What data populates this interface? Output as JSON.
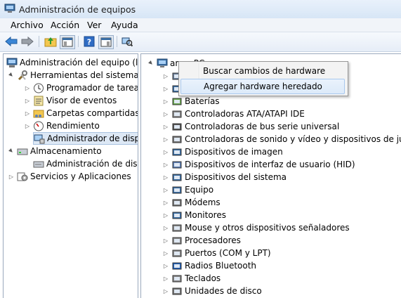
{
  "window": {
    "title": "Administración de equipos"
  },
  "menu": [
    "Archivo",
    "Acción",
    "Ver",
    "Ayuda"
  ],
  "left_tree": [
    {
      "label": "Administración del equipo (loc",
      "level": 0,
      "expander": "",
      "icon": "computer-management-icon"
    },
    {
      "label": "Herramientas del sistema",
      "level": 1,
      "expander": "▲",
      "icon": "tools-icon"
    },
    {
      "label": "Programador de tareas",
      "level": 2,
      "expander": "▷",
      "icon": "clock-icon"
    },
    {
      "label": "Visor de eventos",
      "level": 2,
      "expander": "▷",
      "icon": "event-viewer-icon"
    },
    {
      "label": "Carpetas compartidas",
      "level": 2,
      "expander": "▷",
      "icon": "shared-folder-icon"
    },
    {
      "label": "Rendimiento",
      "level": 2,
      "expander": "▷",
      "icon": "performance-icon"
    },
    {
      "label": "Administrador de dispo",
      "level": 2,
      "expander": "",
      "icon": "device-manager-icon",
      "selected": true
    },
    {
      "label": "Almacenamiento",
      "level": 1,
      "expander": "▲",
      "icon": "storage-icon"
    },
    {
      "label": "Administración de disco",
      "level": 2,
      "expander": "",
      "icon": "disk-management-icon"
    },
    {
      "label": "Servicios y Aplicaciones",
      "level": 1,
      "expander": "▷",
      "icon": "services-icon"
    }
  ],
  "device_tree": {
    "root": "angy-PC",
    "items": [
      {
        "label": "",
        "icon": "disk-drive-icon"
      },
      {
        "label": "",
        "icon": "network-adapter-icon"
      },
      {
        "label": "Baterías",
        "icon": "battery-icon"
      },
      {
        "label": "Controladoras ATA/ATAPI IDE",
        "icon": "ide-controller-icon"
      },
      {
        "label": "Controladoras de bus serie universal",
        "icon": "usb-icon"
      },
      {
        "label": "Controladoras de sonido y vídeo y dispositivos de juego",
        "icon": "sound-icon"
      },
      {
        "label": "Dispositivos de imagen",
        "icon": "imaging-icon"
      },
      {
        "label": "Dispositivos de interfaz de usuario (HID)",
        "icon": "hid-icon"
      },
      {
        "label": "Dispositivos del sistema",
        "icon": "system-devices-icon"
      },
      {
        "label": "Equipo",
        "icon": "computer-icon"
      },
      {
        "label": "Módems",
        "icon": "modem-icon"
      },
      {
        "label": "Monitores",
        "icon": "monitor-icon"
      },
      {
        "label": "Mouse y otros dispositivos señaladores",
        "icon": "mouse-icon"
      },
      {
        "label": "Procesadores",
        "icon": "processor-icon"
      },
      {
        "label": "Puertos (COM y LPT)",
        "icon": "ports-icon"
      },
      {
        "label": "Radios Bluetooth",
        "icon": "bluetooth-icon"
      },
      {
        "label": "Teclados",
        "icon": "keyboard-icon"
      },
      {
        "label": "Unidades de disco",
        "icon": "disk-drive-icon"
      }
    ]
  },
  "context_menu": {
    "items": [
      "Buscar cambios de hardware",
      "Agregar hardware heredado"
    ],
    "highlighted_index": 1
  }
}
